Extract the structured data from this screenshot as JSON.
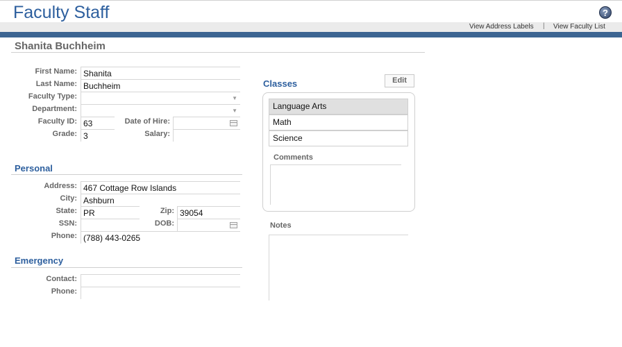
{
  "app": {
    "title": "Faculty Staff",
    "help_symbol": "?"
  },
  "top_links": {
    "address_labels": "View Address Labels",
    "separator": "|",
    "faculty_list": "View Faculty List"
  },
  "record": {
    "name": "Shanita Buchheim"
  },
  "general": {
    "first_name_label": "First Name:",
    "first_name": "Shanita",
    "last_name_label": "Last Name:",
    "last_name": "Buchheim",
    "faculty_type_label": "Faculty Type:",
    "faculty_type": "",
    "department_label": "Department:",
    "department": "",
    "faculty_id_label": "Faculty ID:",
    "faculty_id": "63",
    "date_of_hire_label": "Date of Hire:",
    "date_of_hire": "",
    "grade_label": "Grade:",
    "grade": "3",
    "salary_label": "Salary:",
    "salary": ""
  },
  "personal": {
    "title": "Personal",
    "address_label": "Address:",
    "address": "467 Cottage Row Islands",
    "city_label": "City:",
    "city": "Ashburn",
    "state_label": "State:",
    "state": "PR",
    "zip_label": "Zip:",
    "zip": "39054",
    "ssn_label": "SSN:",
    "ssn": "",
    "dob_label": "DOB:",
    "dob": "",
    "phone_label": "Phone:",
    "phone": "(788) 443-0265"
  },
  "emergency": {
    "title": "Emergency",
    "contact_label": "Contact:",
    "contact": "",
    "phone_label": "Phone:",
    "phone": ""
  },
  "classes": {
    "title": "Classes",
    "edit_label": "Edit",
    "items": [
      "Language Arts",
      "Math",
      "Science"
    ],
    "comments_label": "Comments"
  },
  "notes": {
    "label": "Notes"
  },
  "colors": {
    "accent": "#2d5f9e",
    "bar": "#3c6592"
  }
}
